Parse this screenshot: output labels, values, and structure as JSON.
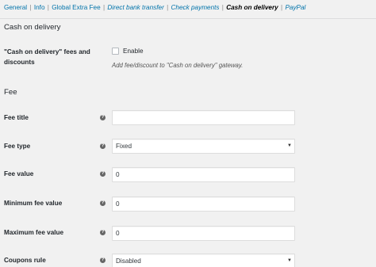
{
  "subnav": {
    "items": [
      "General",
      "Info",
      "Global Extra Fee",
      "Direct bank transfer",
      "Check payments",
      "Cash on delivery",
      "PayPal"
    ],
    "separator": "|"
  },
  "sections": {
    "cod_title": "Cash on delivery",
    "fee_title": "Fee"
  },
  "enable_row": {
    "label": "\"Cash on delivery\" fees and discounts",
    "checkbox_label": "Enable",
    "description": "Add fee/discount to \"Cash on delivery\" gateway."
  },
  "help_glyph": "?",
  "fields": {
    "fee_title": {
      "label": "Fee title",
      "value": ""
    },
    "fee_type": {
      "label": "Fee type",
      "value": "Fixed"
    },
    "fee_value": {
      "label": "Fee value",
      "value": "0"
    },
    "min_fee": {
      "label": "Minimum fee value",
      "value": "0"
    },
    "max_fee": {
      "label": "Maximum fee value",
      "value": "0"
    },
    "coupons_rule": {
      "label": "Coupons rule",
      "value": "Disabled"
    }
  },
  "arrow_glyph": "▼",
  "colors": {
    "link": "#0073aa",
    "background": "#f1f1f1",
    "help_icon": "#666666"
  }
}
